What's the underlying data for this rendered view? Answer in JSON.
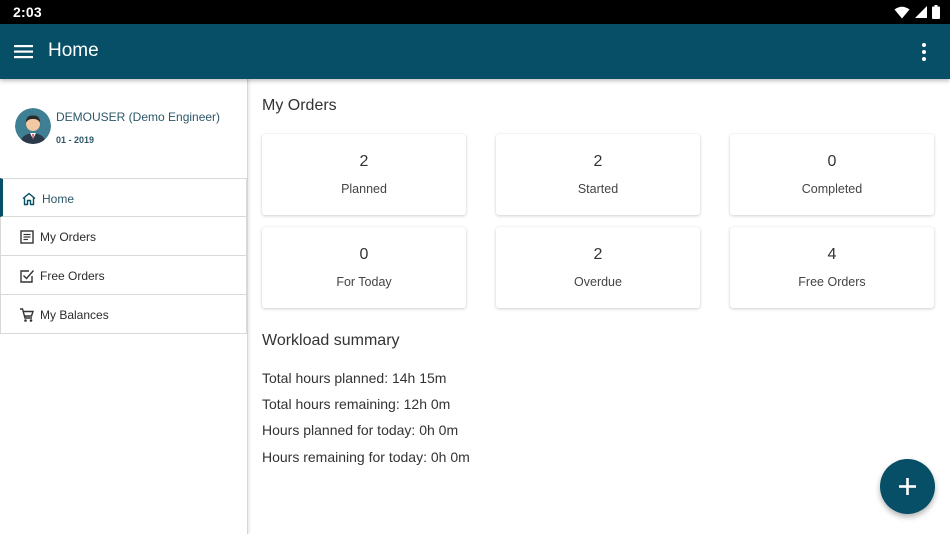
{
  "status_bar": {
    "time": "2:03"
  },
  "app_bar": {
    "title": "Home"
  },
  "profile": {
    "user": "DEMOUSER (Demo Engineer)",
    "period": "01 - 2019"
  },
  "nav": {
    "items": [
      {
        "label": "Home",
        "icon": "home-icon",
        "active": true
      },
      {
        "label": "My Orders",
        "icon": "orders-list-icon",
        "active": false
      },
      {
        "label": "Free Orders",
        "icon": "checkbox-icon",
        "active": false
      },
      {
        "label": "My Balances",
        "icon": "cart-icon",
        "active": false
      }
    ]
  },
  "orders": {
    "title": "My Orders",
    "cards": [
      {
        "count": "2",
        "label": "Planned"
      },
      {
        "count": "2",
        "label": "Started"
      },
      {
        "count": "0",
        "label": "Completed"
      },
      {
        "count": "0",
        "label": "For Today"
      },
      {
        "count": "2",
        "label": "Overdue"
      },
      {
        "count": "4",
        "label": "Free Orders"
      }
    ]
  },
  "workload": {
    "title": "Workload summary",
    "lines": [
      "Total hours planned: 14h 15m",
      "Total hours remaining: 12h 0m",
      "Hours planned for today: 0h 0m",
      "Hours remaining for today: 0h 0m"
    ]
  },
  "colors": {
    "primary": "#064f66",
    "text_dark": "#333333",
    "profile_text": "#2d5768"
  }
}
